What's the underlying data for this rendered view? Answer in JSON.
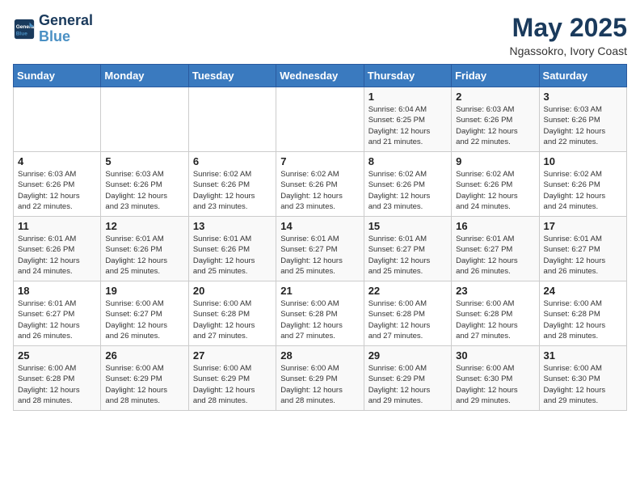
{
  "logo": {
    "line1": "General",
    "line2": "Blue"
  },
  "title": "May 2025",
  "subtitle": "Ngassokro, Ivory Coast",
  "weekdays": [
    "Sunday",
    "Monday",
    "Tuesday",
    "Wednesday",
    "Thursday",
    "Friday",
    "Saturday"
  ],
  "weeks": [
    [
      {
        "day": "",
        "info": ""
      },
      {
        "day": "",
        "info": ""
      },
      {
        "day": "",
        "info": ""
      },
      {
        "day": "",
        "info": ""
      },
      {
        "day": "1",
        "info": "Sunrise: 6:04 AM\nSunset: 6:25 PM\nDaylight: 12 hours\nand 21 minutes."
      },
      {
        "day": "2",
        "info": "Sunrise: 6:03 AM\nSunset: 6:26 PM\nDaylight: 12 hours\nand 22 minutes."
      },
      {
        "day": "3",
        "info": "Sunrise: 6:03 AM\nSunset: 6:26 PM\nDaylight: 12 hours\nand 22 minutes."
      }
    ],
    [
      {
        "day": "4",
        "info": "Sunrise: 6:03 AM\nSunset: 6:26 PM\nDaylight: 12 hours\nand 22 minutes."
      },
      {
        "day": "5",
        "info": "Sunrise: 6:03 AM\nSunset: 6:26 PM\nDaylight: 12 hours\nand 23 minutes."
      },
      {
        "day": "6",
        "info": "Sunrise: 6:02 AM\nSunset: 6:26 PM\nDaylight: 12 hours\nand 23 minutes."
      },
      {
        "day": "7",
        "info": "Sunrise: 6:02 AM\nSunset: 6:26 PM\nDaylight: 12 hours\nand 23 minutes."
      },
      {
        "day": "8",
        "info": "Sunrise: 6:02 AM\nSunset: 6:26 PM\nDaylight: 12 hours\nand 23 minutes."
      },
      {
        "day": "9",
        "info": "Sunrise: 6:02 AM\nSunset: 6:26 PM\nDaylight: 12 hours\nand 24 minutes."
      },
      {
        "day": "10",
        "info": "Sunrise: 6:02 AM\nSunset: 6:26 PM\nDaylight: 12 hours\nand 24 minutes."
      }
    ],
    [
      {
        "day": "11",
        "info": "Sunrise: 6:01 AM\nSunset: 6:26 PM\nDaylight: 12 hours\nand 24 minutes."
      },
      {
        "day": "12",
        "info": "Sunrise: 6:01 AM\nSunset: 6:26 PM\nDaylight: 12 hours\nand 25 minutes."
      },
      {
        "day": "13",
        "info": "Sunrise: 6:01 AM\nSunset: 6:26 PM\nDaylight: 12 hours\nand 25 minutes."
      },
      {
        "day": "14",
        "info": "Sunrise: 6:01 AM\nSunset: 6:27 PM\nDaylight: 12 hours\nand 25 minutes."
      },
      {
        "day": "15",
        "info": "Sunrise: 6:01 AM\nSunset: 6:27 PM\nDaylight: 12 hours\nand 25 minutes."
      },
      {
        "day": "16",
        "info": "Sunrise: 6:01 AM\nSunset: 6:27 PM\nDaylight: 12 hours\nand 26 minutes."
      },
      {
        "day": "17",
        "info": "Sunrise: 6:01 AM\nSunset: 6:27 PM\nDaylight: 12 hours\nand 26 minutes."
      }
    ],
    [
      {
        "day": "18",
        "info": "Sunrise: 6:01 AM\nSunset: 6:27 PM\nDaylight: 12 hours\nand 26 minutes."
      },
      {
        "day": "19",
        "info": "Sunrise: 6:00 AM\nSunset: 6:27 PM\nDaylight: 12 hours\nand 26 minutes."
      },
      {
        "day": "20",
        "info": "Sunrise: 6:00 AM\nSunset: 6:28 PM\nDaylight: 12 hours\nand 27 minutes."
      },
      {
        "day": "21",
        "info": "Sunrise: 6:00 AM\nSunset: 6:28 PM\nDaylight: 12 hours\nand 27 minutes."
      },
      {
        "day": "22",
        "info": "Sunrise: 6:00 AM\nSunset: 6:28 PM\nDaylight: 12 hours\nand 27 minutes."
      },
      {
        "day": "23",
        "info": "Sunrise: 6:00 AM\nSunset: 6:28 PM\nDaylight: 12 hours\nand 27 minutes."
      },
      {
        "day": "24",
        "info": "Sunrise: 6:00 AM\nSunset: 6:28 PM\nDaylight: 12 hours\nand 28 minutes."
      }
    ],
    [
      {
        "day": "25",
        "info": "Sunrise: 6:00 AM\nSunset: 6:28 PM\nDaylight: 12 hours\nand 28 minutes."
      },
      {
        "day": "26",
        "info": "Sunrise: 6:00 AM\nSunset: 6:29 PM\nDaylight: 12 hours\nand 28 minutes."
      },
      {
        "day": "27",
        "info": "Sunrise: 6:00 AM\nSunset: 6:29 PM\nDaylight: 12 hours\nand 28 minutes."
      },
      {
        "day": "28",
        "info": "Sunrise: 6:00 AM\nSunset: 6:29 PM\nDaylight: 12 hours\nand 28 minutes."
      },
      {
        "day": "29",
        "info": "Sunrise: 6:00 AM\nSunset: 6:29 PM\nDaylight: 12 hours\nand 29 minutes."
      },
      {
        "day": "30",
        "info": "Sunrise: 6:00 AM\nSunset: 6:30 PM\nDaylight: 12 hours\nand 29 minutes."
      },
      {
        "day": "31",
        "info": "Sunrise: 6:00 AM\nSunset: 6:30 PM\nDaylight: 12 hours\nand 29 minutes."
      }
    ]
  ]
}
